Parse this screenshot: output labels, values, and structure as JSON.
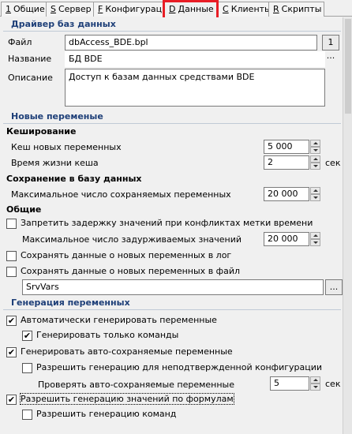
{
  "tabs": [
    {
      "accel": "1",
      "label": "Общие"
    },
    {
      "accel": "S",
      "label": "Сервер"
    },
    {
      "accel": "F",
      "label": "Конфигурации"
    },
    {
      "accel": "D",
      "label": "Данные"
    },
    {
      "accel": "C",
      "label": "Клиенты"
    },
    {
      "accel": "R",
      "label": "Скрипты"
    }
  ],
  "active_tab": "Данные",
  "driver": {
    "header": "Драйвер баз данных",
    "file_label": "Файл",
    "file_value": "dbAccess_BDE.bpl",
    "browse_label": "1 ...",
    "name_label": "Название",
    "name_value": "БД BDE",
    "desc_label": "Описание",
    "desc_value": "Доступ к базам данных средствами BDE"
  },
  "new_vars": {
    "header": "Новые переменые",
    "cache_title": "Кеширование",
    "cache_new_label": "Кеш новых переменных",
    "cache_new_value": "5 000",
    "cache_ttl_label": "Время жизни кеша",
    "cache_ttl_value": "2",
    "cache_ttl_unit": "сек",
    "save_title": "Сохранение в базу данных",
    "save_max_label": "Максимальное число сохраняемых переменных",
    "save_max_value": "20 000",
    "general_title": "Общие",
    "forbid_delay_label": "Запретить задержку значений при конфликтах метки времени",
    "forbid_delay_checked": false,
    "max_delayed_label": "Максимальное число задурживаемых значений",
    "max_delayed_value": "20 000",
    "save_log_label": "Сохранять данные о новых переменных в лог",
    "save_log_checked": false,
    "save_file_label": "Сохранять данные о новых переменных в файл",
    "save_file_checked": false,
    "file_value": "SrvVars",
    "file_browse_label": "..."
  },
  "generation": {
    "header": "Генерация переменных",
    "auto_gen_label": "Автоматически генерировать переменные",
    "auto_gen_checked": true,
    "only_commands_label": "Генерировать только команды",
    "only_commands_checked": true,
    "gen_autosave_label": "Генерировать авто-сохраняемые переменные",
    "gen_autosave_checked": true,
    "allow_unconfirmed_label": "Разрешить генерацию для неподтвержденной конфигурации",
    "allow_unconfirmed_checked": false,
    "check_autosave_label": "Проверять авто-сохраняемые переменные",
    "check_autosave_value": "5",
    "check_autosave_unit": "сек",
    "allow_formula_label": "Разрешить генерацию значений по формулам",
    "allow_formula_checked": true,
    "allow_commands_label": "Разрешить генерацию команд",
    "allow_commands_checked": false
  },
  "colors": {
    "active_tab_highlight": "#e81d25",
    "section_header_text": "#1e3f78"
  }
}
